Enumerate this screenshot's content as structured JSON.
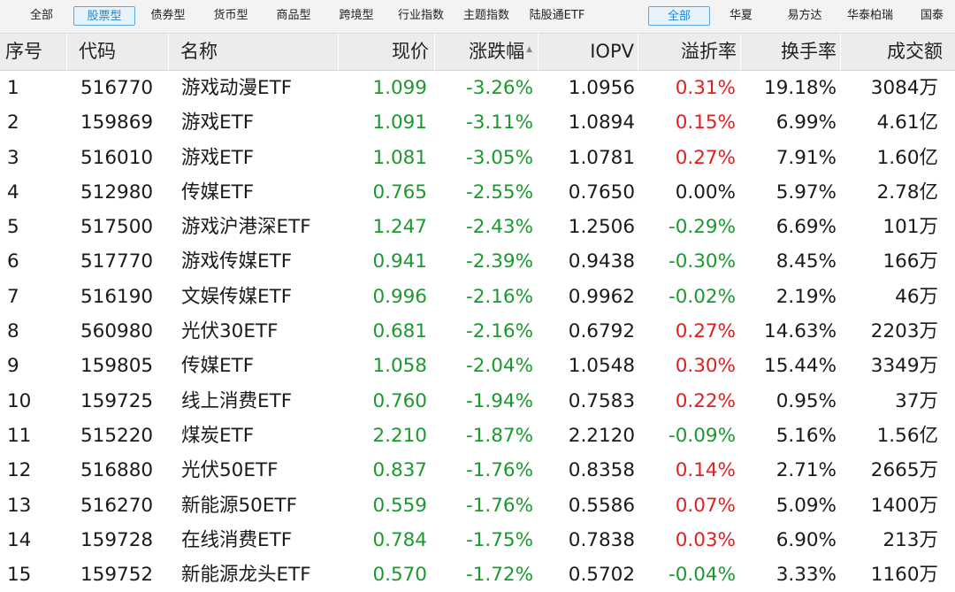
{
  "filter_bar": {
    "types": [
      {
        "label": "全部",
        "active": false
      },
      {
        "label": "股票型",
        "active": true
      },
      {
        "label": "债券型",
        "active": false
      },
      {
        "label": "货币型",
        "active": false
      },
      {
        "label": "商品型",
        "active": false
      },
      {
        "label": "跨境型",
        "active": false
      },
      {
        "label": "行业指数",
        "active": false
      },
      {
        "label": "主题指数",
        "active": false
      },
      {
        "label": "陆股通ETF",
        "active": false
      }
    ],
    "companies": [
      {
        "label": "全部",
        "active": true
      },
      {
        "label": "华夏",
        "active": false
      },
      {
        "label": "易方达",
        "active": false
      },
      {
        "label": "华泰柏瑞",
        "active": false
      },
      {
        "label": "国泰",
        "active": false
      }
    ]
  },
  "table": {
    "columns": [
      "序号",
      "代码",
      "名称",
      "现价",
      "涨跌幅",
      "IOPV",
      "溢折率",
      "换手率",
      "成交额"
    ],
    "sorted_column": "涨跌幅",
    "sort_indicator": "▲",
    "colors": {
      "up": "#e02020",
      "down": "#1a9a2e",
      "flat": "#1a1a1a"
    },
    "rows": [
      {
        "idx": "1",
        "code": "516770",
        "name": "游戏动漫ETF",
        "price": "1.099",
        "change": "-3.26%",
        "iopv": "1.0956",
        "premium": "0.31%",
        "turnover": "19.18%",
        "volume": "3084万"
      },
      {
        "idx": "2",
        "code": "159869",
        "name": "游戏ETF",
        "price": "1.091",
        "change": "-3.11%",
        "iopv": "1.0894",
        "premium": "0.15%",
        "turnover": "6.99%",
        "volume": "4.61亿"
      },
      {
        "idx": "3",
        "code": "516010",
        "name": "游戏ETF",
        "price": "1.081",
        "change": "-3.05%",
        "iopv": "1.0781",
        "premium": "0.27%",
        "turnover": "7.91%",
        "volume": "1.60亿"
      },
      {
        "idx": "4",
        "code": "512980",
        "name": "传媒ETF",
        "price": "0.765",
        "change": "-2.55%",
        "iopv": "0.7650",
        "premium": "0.00%",
        "turnover": "5.97%",
        "volume": "2.78亿"
      },
      {
        "idx": "5",
        "code": "517500",
        "name": "游戏沪港深ETF",
        "price": "1.247",
        "change": "-2.43%",
        "iopv": "1.2506",
        "premium": "-0.29%",
        "turnover": "6.69%",
        "volume": "101万"
      },
      {
        "idx": "6",
        "code": "517770",
        "name": "游戏传媒ETF",
        "price": "0.941",
        "change": "-2.39%",
        "iopv": "0.9438",
        "premium": "-0.30%",
        "turnover": "8.45%",
        "volume": "166万"
      },
      {
        "idx": "7",
        "code": "516190",
        "name": "文娱传媒ETF",
        "price": "0.996",
        "change": "-2.16%",
        "iopv": "0.9962",
        "premium": "-0.02%",
        "turnover": "2.19%",
        "volume": "46万"
      },
      {
        "idx": "8",
        "code": "560980",
        "name": "光伏30ETF",
        "price": "0.681",
        "change": "-2.16%",
        "iopv": "0.6792",
        "premium": "0.27%",
        "turnover": "14.63%",
        "volume": "2203万"
      },
      {
        "idx": "9",
        "code": "159805",
        "name": "传媒ETF",
        "price": "1.058",
        "change": "-2.04%",
        "iopv": "1.0548",
        "premium": "0.30%",
        "turnover": "15.44%",
        "volume": "3349万"
      },
      {
        "idx": "10",
        "code": "159725",
        "name": "线上消费ETF",
        "price": "0.760",
        "change": "-1.94%",
        "iopv": "0.7583",
        "premium": "0.22%",
        "turnover": "0.95%",
        "volume": "37万"
      },
      {
        "idx": "11",
        "code": "515220",
        "name": "煤炭ETF",
        "price": "2.210",
        "change": "-1.87%",
        "iopv": "2.2120",
        "premium": "-0.09%",
        "turnover": "5.16%",
        "volume": "1.56亿"
      },
      {
        "idx": "12",
        "code": "516880",
        "name": "光伏50ETF",
        "price": "0.837",
        "change": "-1.76%",
        "iopv": "0.8358",
        "premium": "0.14%",
        "turnover": "2.71%",
        "volume": "2665万"
      },
      {
        "idx": "13",
        "code": "516270",
        "name": "新能源50ETF",
        "price": "0.559",
        "change": "-1.76%",
        "iopv": "0.5586",
        "premium": "0.07%",
        "turnover": "5.09%",
        "volume": "1400万"
      },
      {
        "idx": "14",
        "code": "159728",
        "name": "在线消费ETF",
        "price": "0.784",
        "change": "-1.75%",
        "iopv": "0.7838",
        "premium": "0.03%",
        "turnover": "6.90%",
        "volume": "213万"
      },
      {
        "idx": "15",
        "code": "159752",
        "name": "新能源龙头ETF",
        "price": "0.570",
        "change": "-1.72%",
        "iopv": "0.5702",
        "premium": "-0.04%",
        "turnover": "3.33%",
        "volume": "1160万"
      }
    ]
  }
}
